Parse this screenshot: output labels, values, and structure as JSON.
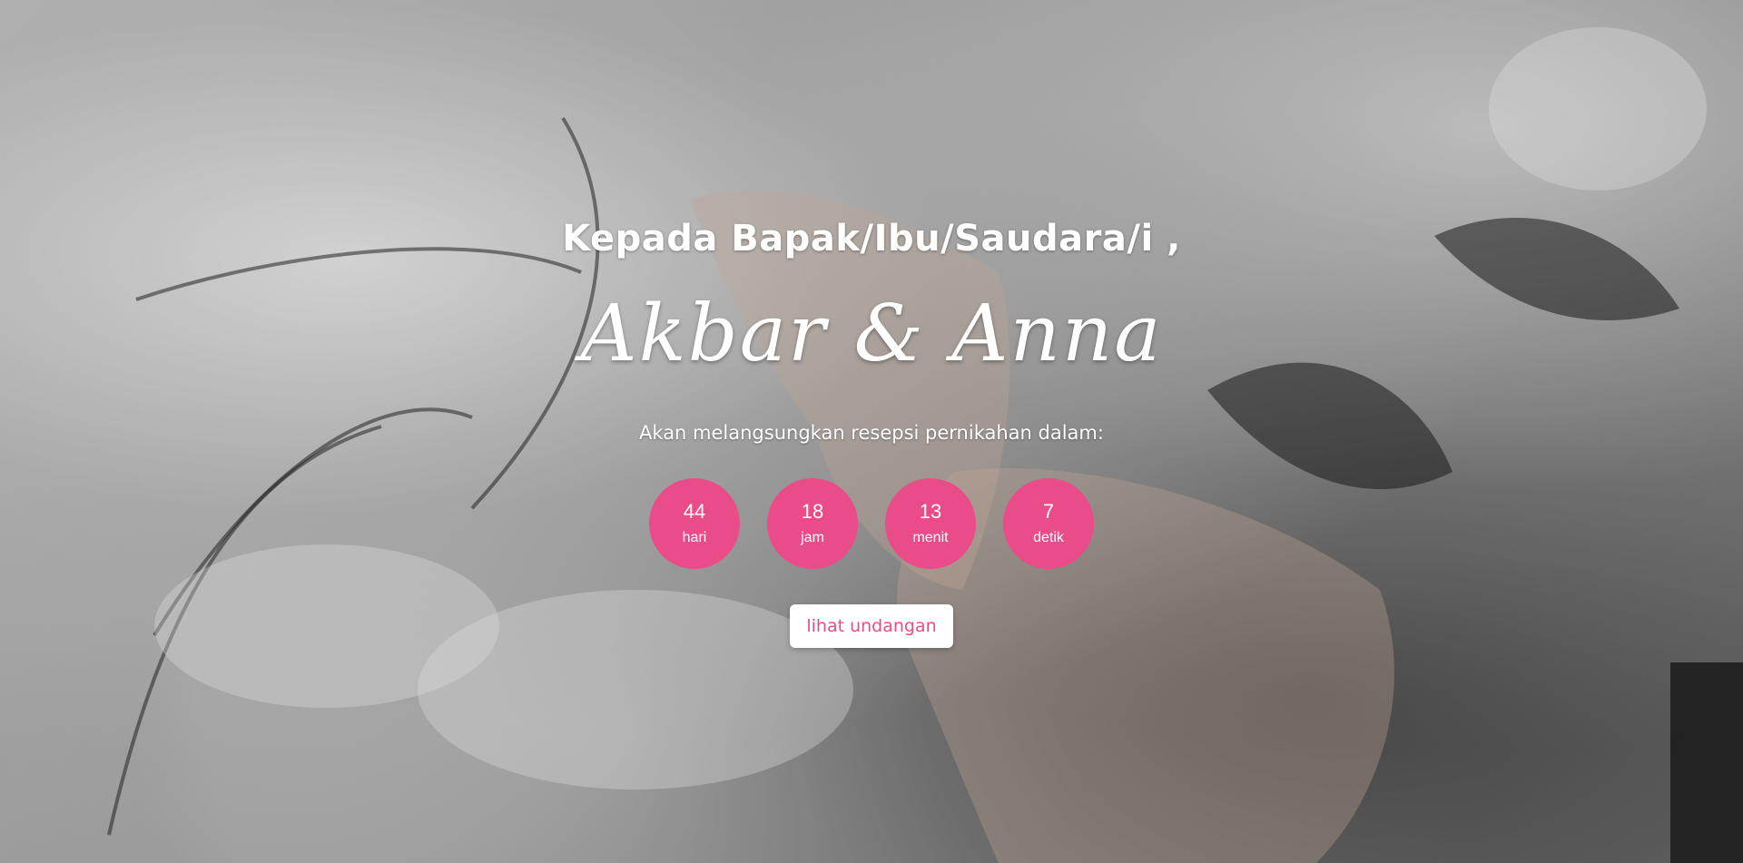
{
  "hero": {
    "greeting": "Kepada Bapak/Ibu/Saudara/i ,",
    "couple_names": "Akbar & Anna",
    "subtitle": "Akan melangsungkan resepsi pernikahan dalam:"
  },
  "countdown": [
    {
      "value": "44",
      "unit": "hari"
    },
    {
      "value": "18",
      "unit": "jam"
    },
    {
      "value": "13",
      "unit": "menit"
    },
    {
      "value": "7",
      "unit": "detik"
    }
  ],
  "cta": {
    "label": "lihat undangan"
  },
  "colors": {
    "accent": "#ea4c89",
    "text": "#ffffff",
    "button_bg": "#ffffff"
  }
}
